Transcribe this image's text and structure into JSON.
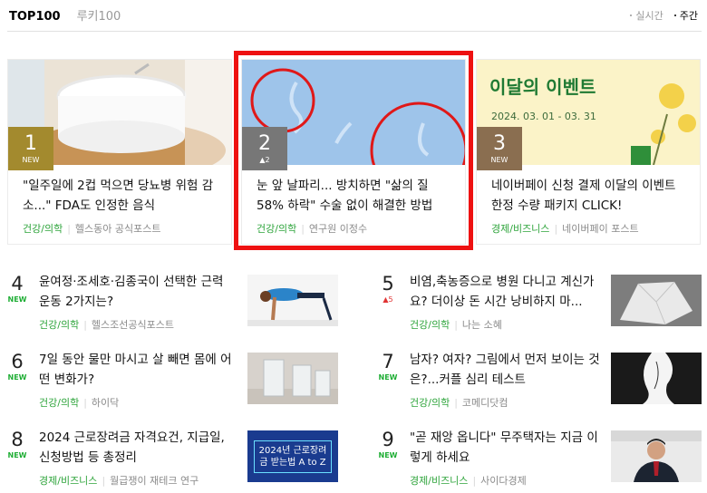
{
  "tabs": {
    "active": "TOP100",
    "inactive": "루키100"
  },
  "periods": [
    {
      "label": "실시간",
      "active": false
    },
    {
      "label": "주간",
      "active": true
    }
  ],
  "top_cards": [
    {
      "rank": "1",
      "badge": "NEW",
      "title": "\"일주일에 2컵 먹으면 당뇨병 위험 감소...\" FDA도 인정한 음식",
      "category": "건강/의학",
      "source": "헬스동아 공식포스트",
      "rank_bg": "#a38a2e"
    },
    {
      "rank": "2",
      "badge": "▲2",
      "title": "눈 앞 날파리... 방치하면 \"삶의 질 58% 하락\" 수술 없이 해결한 방법",
      "category": "건강/의학",
      "source": "연구원 이정수",
      "rank_bg": "#777777"
    },
    {
      "rank": "3",
      "badge": "NEW",
      "title": "네이버페이 신청 결제 이달의 이벤트 한정 수량 패키지 CLICK!",
      "category": "경제/비즈니스",
      "source": "네이버페이 포스트",
      "rank_bg": "#8a6e50",
      "banner_top": "이달의 이벤트",
      "banner_date": "2024. 03. 01 - 03. 31"
    }
  ],
  "list": [
    {
      "rank": "4",
      "badge": "NEW",
      "title": "윤여정·조세호·김종국이 선택한 근력 운동 2가지는?",
      "category": "건강/의학",
      "source": "헬스조선공식포스트"
    },
    {
      "rank": "5",
      "badge": "▲5",
      "title": "비염,축농증으로 병원 다니고 계신가요? 더이상 돈 시간 낭비하지 마...",
      "category": "건강/의학",
      "source": "나는 소혜"
    },
    {
      "rank": "6",
      "badge": "NEW",
      "title": "7일 동안 물만 마시고 살 빼면 몸에 어떤 변화가?",
      "category": "건강/의학",
      "source": "하이닥"
    },
    {
      "rank": "7",
      "badge": "NEW",
      "title": "남자? 여자? 그림에서 먼저 보이는 것은?...커플 심리 테스트",
      "category": "건강/의학",
      "source": "코메디닷컴"
    },
    {
      "rank": "8",
      "badge": "NEW",
      "title": "2024 근로장려금 자격요건, 지급일, 신청방법 등 총정리",
      "category": "경제/비즈니스",
      "source": "월급쟁이 재테크 연구",
      "thumb_text": "2024년 근로장려금 받는법 A to Z"
    },
    {
      "rank": "9",
      "badge": "NEW",
      "title": "\"곧 재앙 옵니다\" 무주택자는 지금 이렇게 하세요",
      "category": "경제/비즈니스",
      "source": "사이다경제"
    }
  ]
}
